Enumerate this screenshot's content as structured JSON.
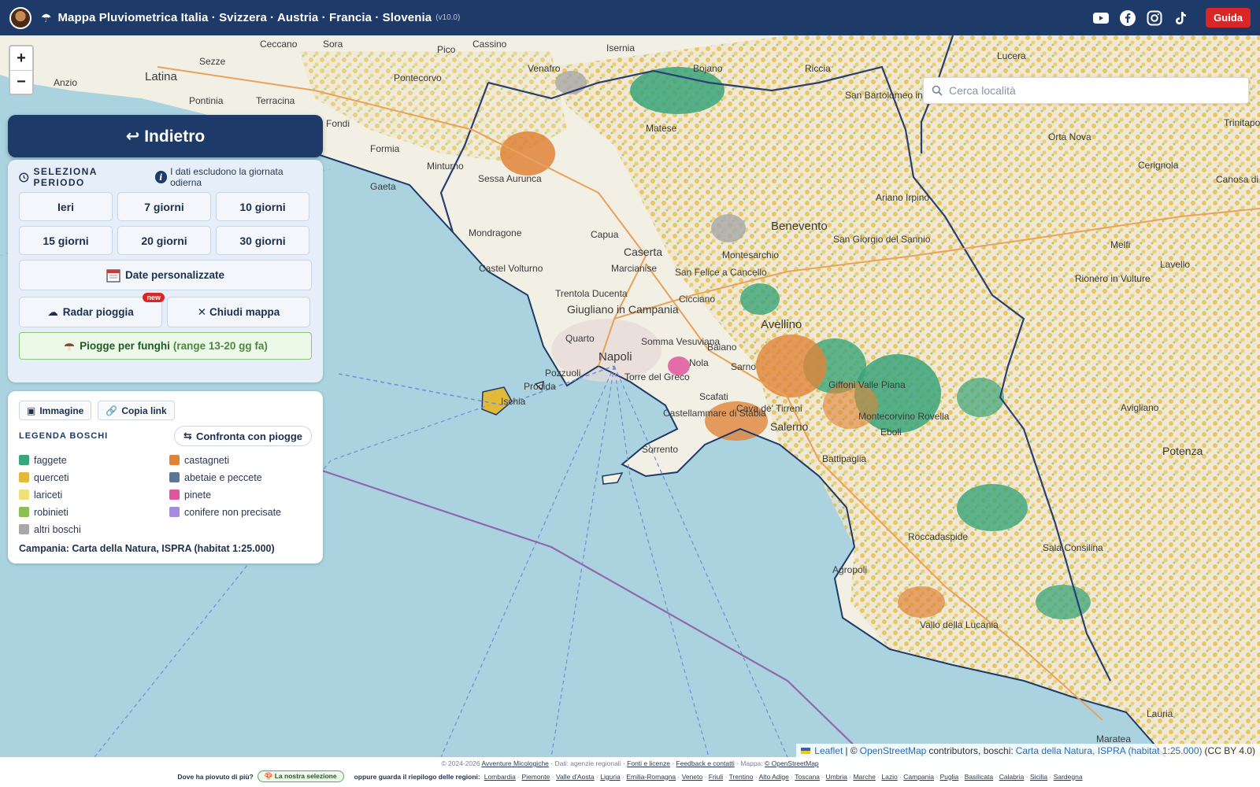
{
  "header": {
    "title": "Mappa Pluviometrica Italia · Svizzera · Austria · Francia · Slovenia",
    "version": "(v10.0)",
    "guide_label": "Guida",
    "social_icons": [
      "youtube-icon",
      "facebook-icon",
      "instagram-icon",
      "tiktok-icon"
    ]
  },
  "search": {
    "placeholder": "Cerca località"
  },
  "zoom": {
    "in": "+",
    "out": "−"
  },
  "back": {
    "label": "↩ Indietro"
  },
  "period": {
    "title": "SELEZIONA PERIODO",
    "note": "I dati escludono la giornata odierna",
    "buttons": [
      "Ieri",
      "7 giorni",
      "10 giorni",
      "15 giorni",
      "20 giorni",
      "30 giorni"
    ],
    "custom_dates": "Date personalizzate",
    "radar": "Radar pioggia",
    "radar_badge": "new",
    "close_map": "Chiudi mappa",
    "funghi_label": "Piogge per funghi",
    "funghi_range": "(range 13-20 gg fa)"
  },
  "legend": {
    "image_btn": "Immagine",
    "copy_btn": "Copia link",
    "title": "LEGENDA BOSCHI",
    "compare_btn": "Confronta con piogge",
    "items": [
      {
        "label": "faggete",
        "color": "#3aa57a"
      },
      {
        "label": "castagneti",
        "color": "#e0843a"
      },
      {
        "label": "querceti",
        "color": "#e3b93a"
      },
      {
        "label": "abetaie e peccete",
        "color": "#5a7896"
      },
      {
        "label": "lariceti",
        "color": "#f0e07a"
      },
      {
        "label": "pinete",
        "color": "#e0569c"
      },
      {
        "label": "robinieti",
        "color": "#8cbf52"
      },
      {
        "label": "conifere non precisate",
        "color": "#a78bdf"
      },
      {
        "label": "altri boschi",
        "color": "#a8a8a8"
      }
    ],
    "source": "Campania: Carta della Natura, ISPRA (habitat 1:25.000)"
  },
  "map_labels": [
    "Latina",
    "Sezze",
    "Anzio",
    "Pontinia",
    "Terracina",
    "Fondi",
    "Gaeta",
    "Formia",
    "Minturno",
    "Sessa Aurunca",
    "Mondragone",
    "Capua",
    "Caserta",
    "Castel Volturno",
    "Marcianise",
    "Trentola Ducenta",
    "Giugliano in Campania",
    "Quarto",
    "Napoli",
    "Pozzuoli",
    "Procida",
    "Ischia",
    "Torre del Greco",
    "Somma Vesuviana",
    "Scafati",
    "Castellammare di Stabia",
    "Sorrento",
    "Salerno",
    "Cava de' Tirreni",
    "Avellino",
    "Benevento",
    "Montesarchio",
    "San Felice a Cancello",
    "Cicciano",
    "Sarno",
    "Baiano",
    "Nola",
    "Battipaglia",
    "Eboli",
    "Giffoni Valle Piana",
    "Montecorvino Rovella",
    "Roccadaspide",
    "Agropoli",
    "Vallo della Lucania",
    "Sala Consilina",
    "Potenza",
    "Avigliano",
    "Rionero in Vulture",
    "Lavello",
    "Melfi",
    "Ariano Irpino",
    "San Giorgio del Sannio",
    "San Bartolomeo in Galdo",
    "Lucera",
    "Orta Nova",
    "Cerignola",
    "Canosa di Puglia",
    "Trinitapoli",
    "Sora",
    "Cassino",
    "Pontecorvo",
    "Venafro",
    "Matese",
    "Riccia",
    "Bojano",
    "Isernia",
    "Lauria",
    "Maratea",
    "Ceccano",
    "Pico"
  ],
  "attribution": {
    "leaflet": "Leaflet",
    "osm_prefix": "| ©",
    "osm": "OpenStreetMap",
    "contrib": "contributors, boschi:",
    "carta": "Carta della Natura, ISPRA (habitat 1:25.000)",
    "license": "(CC BY 4.0)"
  },
  "footer": {
    "copyright": "© 2024-2026",
    "site": "Avventure Micologiche",
    "data_note": "· Dati: agenzie regionali ·",
    "fonti": "Fonti e licenze",
    "feedback": "Feedback e contatti",
    "map_note": "· Mappa:",
    "osm": "© OpenStreetMap",
    "question": "Dove ha piovuto di più?",
    "selection": "La nostra selezione",
    "regions_intro": "oppure guarda il riepilogo delle regioni:",
    "regions": [
      "Lombardia",
      "Piemonte",
      "Valle d'Aosta",
      "Liguria",
      "Emilia-Romagna",
      "Veneto",
      "Friuli",
      "Trentino",
      "Alto Adige",
      "Toscana",
      "Umbria",
      "Marche",
      "Lazio",
      "Campania",
      "Puglia",
      "Basilicata",
      "Calabria",
      "Sicilia",
      "Sardegna"
    ]
  }
}
